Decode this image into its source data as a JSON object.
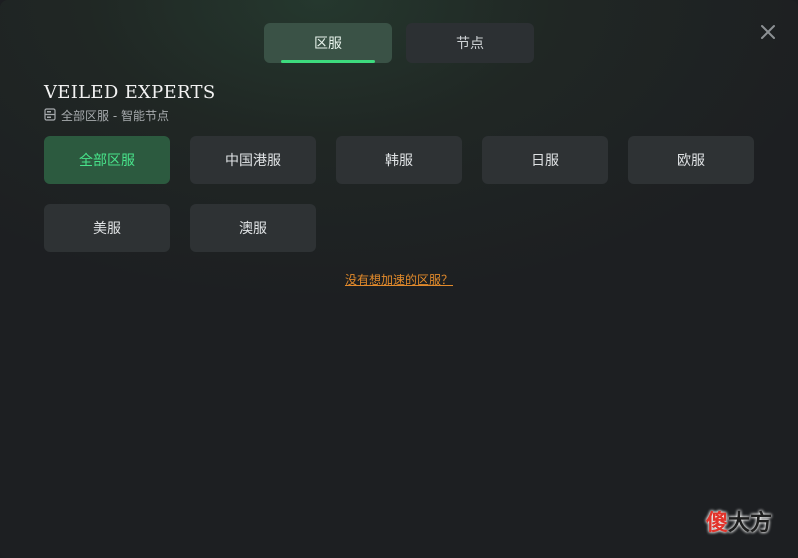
{
  "tabs": [
    {
      "label": "区服",
      "active": true
    },
    {
      "label": "节点",
      "active": false
    }
  ],
  "close_icon": "close-icon",
  "game_title": "VEILED EXPERTS",
  "subtitle": "全部区服 - 智能节点",
  "subtitle_icon": "server-icon",
  "regions": [
    {
      "label": "全部区服",
      "active": true
    },
    {
      "label": "中国港服",
      "active": false
    },
    {
      "label": "韩服",
      "active": false
    },
    {
      "label": "日服",
      "active": false
    },
    {
      "label": "欧服",
      "active": false
    },
    {
      "label": "美服",
      "active": false
    },
    {
      "label": "澳服",
      "active": false
    }
  ],
  "missing_region_link": "没有想加速的区服？",
  "watermark": {
    "part1": "傻",
    "part2": "大方"
  },
  "colors": {
    "accent": "#3ddb7e",
    "link": "#e28a2b"
  }
}
